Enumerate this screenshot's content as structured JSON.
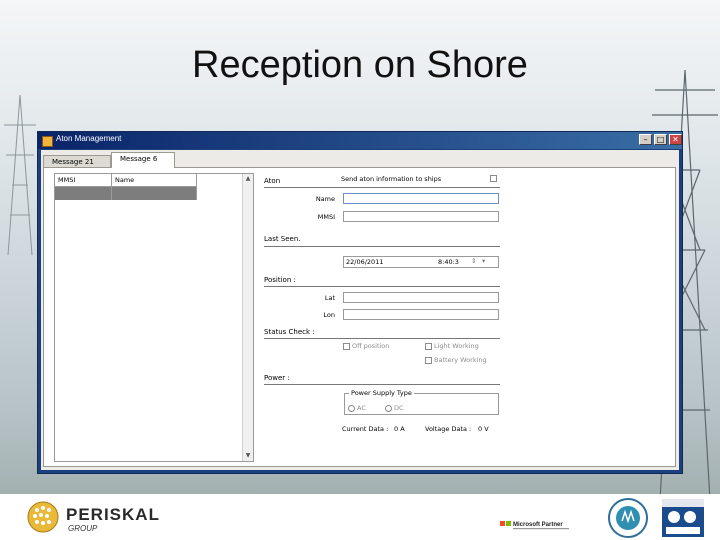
{
  "slide": {
    "title": "Reception on Shore"
  },
  "window": {
    "title": "Aton Management",
    "controls": {
      "minimize": "–",
      "maximize": "□",
      "close": "✕"
    }
  },
  "tabs": [
    {
      "label": "Message 21"
    },
    {
      "label": "Message 6"
    }
  ],
  "grid": {
    "columns": [
      "MMSI",
      "Name"
    ],
    "rows": [
      [
        "",
        ""
      ]
    ]
  },
  "form": {
    "aton_label": "Aton",
    "send_label": "Send aton information to ships",
    "name_label": "Name",
    "mmsi_label": "MMSI",
    "last_seen_label": "Last Seen.",
    "date_value": "22/06/2011",
    "time_value": "8:40:3",
    "position_label": "Position :",
    "lat_label": "Lat",
    "lon_label": "Lon",
    "status_label": "Status Check :",
    "off_position": "Off position",
    "light_working": "Light Working",
    "battery_working": "Battery Working",
    "power_label": "Power :",
    "power_supply_type": "Power Supply Type",
    "ac_label": "AC",
    "dc_label": "DC",
    "current_data_label": "Current Data :",
    "current_data_value": "0 A",
    "voltage_data_label": "Voltage Data :",
    "voltage_data_value": "0 V"
  },
  "footer": {
    "brand": "PERISKAL",
    "brand_sub": "GROUP",
    "partner_logo": "Microsoft Partner"
  },
  "colors": {
    "titlebar": "#0a246a",
    "window_frame": "#1c3f7d",
    "selected_row": "#7d7d7d"
  }
}
